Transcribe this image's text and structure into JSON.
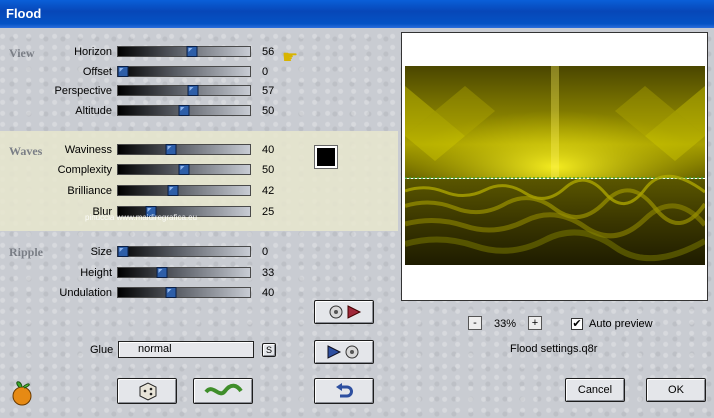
{
  "window": {
    "title": "Flood"
  },
  "sections": {
    "view": "View",
    "waves": "Waves",
    "ripple": "Ripple"
  },
  "sliders": {
    "horizon": {
      "label": "Horizon",
      "value": 56
    },
    "offset": {
      "label": "Offset",
      "value": 0
    },
    "perspective": {
      "label": "Perspective",
      "value": 57
    },
    "altitude": {
      "label": "Altitude",
      "value": 50
    },
    "waviness": {
      "label": "Waviness",
      "value": 40
    },
    "complexity": {
      "label": "Complexity",
      "value": 50
    },
    "brilliance": {
      "label": "Brilliance",
      "value": 42
    },
    "blur": {
      "label": "Blur",
      "value": 25
    },
    "size": {
      "label": "Size",
      "value": 0
    },
    "height": {
      "label": "Height",
      "value": 33
    },
    "undulation": {
      "label": "Undulation",
      "value": 40
    }
  },
  "glue": {
    "label": "Glue",
    "value": "normal",
    "button": "S"
  },
  "zoom": {
    "minus": "-",
    "value": "33%",
    "plus": "+"
  },
  "auto_preview": {
    "label": "Auto preview",
    "checked": true,
    "mark": "✔"
  },
  "settings_file": "Flood settings.q8r",
  "buttons": {
    "cancel": "Cancel",
    "ok": "OK"
  },
  "watermark": "pinuccia www.maidiregrafica.eu",
  "colors": {
    "titlebar": "#0747b8",
    "swatch": "#000000",
    "preview_gold": "#c8c000"
  },
  "icons": {
    "pointer": "pointing-hand-icon",
    "app": "fruit-logo-icon",
    "dice": "dice-icon",
    "wave": "wave-icon",
    "undo": "undo-arrow-icon",
    "load": "disk-load-icon",
    "save": "disk-save-icon"
  }
}
